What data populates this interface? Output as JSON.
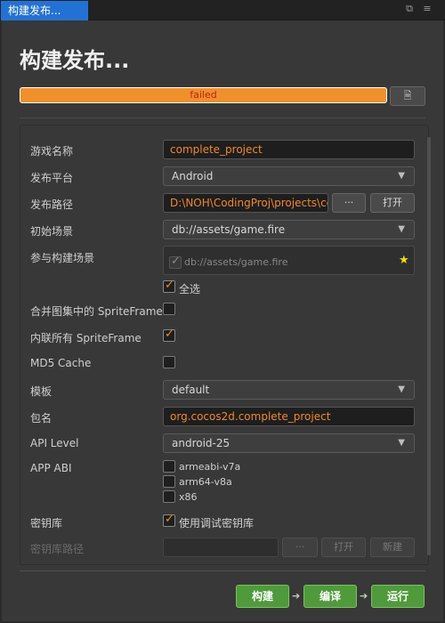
{
  "tab": {
    "title": "构建发布...",
    "icons": [
      "⧉",
      "≡"
    ]
  },
  "panel": {
    "title": "构建发布..."
  },
  "progress": {
    "status": "failed",
    "percent": 100,
    "button_icon": "🗎"
  },
  "form": {
    "game_name": {
      "label": "游戏名称",
      "value": "complete_project"
    },
    "platform": {
      "label": "发布平台",
      "value": "Android",
      "caret": "▼"
    },
    "build_path": {
      "label": "发布路径",
      "value": "D:\\NOH\\CodingProj\\projects\\ccl",
      "browse_label": "···",
      "open_label": "打开"
    },
    "start_scene": {
      "label": "初始场景",
      "value": "db://assets/game.fire",
      "caret": "▼"
    },
    "included_scenes": {
      "label": "参与构建场景",
      "scene": "db://assets/game.fire",
      "star": "★",
      "select_all_label": "全选",
      "select_all_checked": true
    },
    "merge_spriteframe": {
      "label": "合并图集中的 SpriteFrame",
      "checked": false
    },
    "inline_spriteframe": {
      "label": "内联所有 SpriteFrame",
      "checked": true
    },
    "md5_cache": {
      "label": "MD5 Cache",
      "checked": false
    },
    "template": {
      "label": "模板",
      "value": "default",
      "caret": "▼"
    },
    "package_name": {
      "label": "包名",
      "value": "org.cocos2d.complete_project"
    },
    "api_level": {
      "label": "API Level",
      "value": "android-25",
      "caret": "▼"
    },
    "app_abi": {
      "label": "APP ABI",
      "options": [
        "armeabi-v7a",
        "arm64-v8a",
        "x86"
      ]
    },
    "keystore": {
      "label": "密钥库",
      "debug_label": "使用调试密钥库",
      "debug_checked": true
    },
    "keystore_path": {
      "label": "密钥库路径",
      "value": "",
      "browse_label": "···",
      "open_label": "打开",
      "new_label": "新建"
    }
  },
  "actions": {
    "build_label": "构建",
    "compile_label": "编译",
    "run_label": "运行",
    "arrow": "➔"
  },
  "colors": {
    "accent": "#f0892a",
    "tab_active": "#2272d6",
    "button_green": "#4f9a3a",
    "error_text": "#c0201a"
  }
}
